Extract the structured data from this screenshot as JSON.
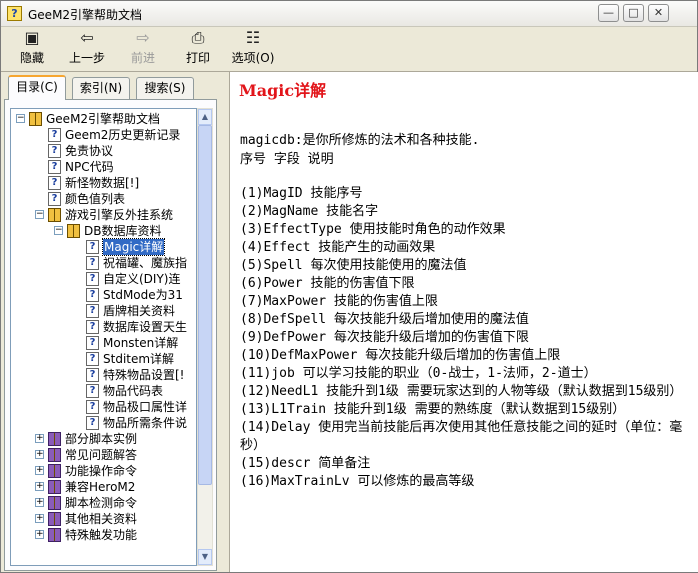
{
  "window": {
    "title": "GeeM2引擎帮助文档",
    "icon": "help-question-icon"
  },
  "title_buttons": {
    "minimize": "—",
    "maximize": "□",
    "close": "✕"
  },
  "toolbar": {
    "hide": "隐藏",
    "back": "上一步",
    "forward": "前进",
    "print": "打印",
    "options": "选项(O)"
  },
  "tabs": [
    "目录(C)",
    "索引(N)",
    "搜索(S)"
  ],
  "tree": [
    {
      "text": "GeeM2引擎帮助文档",
      "type": "book-open",
      "toggle": "−",
      "level": 0
    },
    {
      "text": "Geem2历史更新记录",
      "type": "page",
      "level": 1
    },
    {
      "text": "免责协议",
      "type": "page",
      "level": 1
    },
    {
      "text": "NPC代码",
      "type": "page",
      "level": 1
    },
    {
      "text": "新怪物数据[!]",
      "type": "page",
      "level": 1
    },
    {
      "text": "颜色值列表",
      "type": "page",
      "level": 1
    },
    {
      "text": "游戏引擎反外挂系统",
      "type": "book-open",
      "toggle": "−",
      "level": 1
    },
    {
      "text": "DB数据库资料",
      "type": "book-open",
      "toggle": "−",
      "level": 2
    },
    {
      "text": "Magic详解",
      "type": "page",
      "level": 3,
      "selected": true
    },
    {
      "text": "祝福罐、魔族指",
      "type": "page",
      "level": 3
    },
    {
      "text": "自定义(DIY)连",
      "type": "page",
      "level": 3
    },
    {
      "text": "StdMode为31",
      "type": "page",
      "level": 3
    },
    {
      "text": "盾牌相关资料",
      "type": "page",
      "level": 3
    },
    {
      "text": "数据库设置天生",
      "type": "page",
      "level": 3
    },
    {
      "text": "Monsten详解",
      "type": "page",
      "level": 3
    },
    {
      "text": "Stditem详解",
      "type": "page",
      "level": 3
    },
    {
      "text": "特殊物品设置[!",
      "type": "page",
      "level": 3
    },
    {
      "text": "物品代码表",
      "type": "page",
      "level": 3
    },
    {
      "text": "物品极口属性详",
      "type": "page",
      "level": 3
    },
    {
      "text": "物品所需条件说",
      "type": "page",
      "level": 3
    },
    {
      "text": "部分脚本实例",
      "type": "book-closed",
      "toggle": "+",
      "level": 1
    },
    {
      "text": "常见问题解答",
      "type": "book-closed",
      "toggle": "+",
      "level": 1
    },
    {
      "text": "功能操作命令",
      "type": "book-closed",
      "toggle": "+",
      "level": 1
    },
    {
      "text": "兼容HeroM2",
      "type": "book-closed",
      "toggle": "+",
      "level": 1
    },
    {
      "text": "脚本检测命令",
      "type": "book-closed",
      "toggle": "+",
      "level": 1
    },
    {
      "text": "其他相关资料",
      "type": "book-closed",
      "toggle": "+",
      "level": 1
    },
    {
      "text": "特殊触发功能",
      "type": "book-closed",
      "toggle": "+",
      "level": 1
    }
  ],
  "content": {
    "title": "Magic详解",
    "intro": "magicdb:是你所修炼的法术和各种技能.",
    "header": " 序号 字段 说明",
    "fields": [
      "(1)MagID 技能序号",
      " (2)MagName 技能名字",
      " (3)EffectType 使用技能时角色的动作效果",
      " (4)Effect 技能产生的动画效果",
      " (5)Spell 每次使用技能使用的魔法值",
      " (6)Power 技能的伤害值下限",
      " (7)MaxPower 技能的伤害值上限",
      "(8)DefSpell 每次技能升级后增加使用的魔法值",
      " (9)DefPower 每次技能升级后增加的伤害值下限",
      " (10)DefMaxPower 每次技能升级后增加的伤害值上限",
      " (11)job 可以学习技能的职业（0-战士，1-法师，2-道士）",
      " (12)NeedL1 技能升到1级 需要玩家达到的人物等级（默认数据到15级别）",
      " (13)L1Train 技能升到1级 需要的熟练度（默认数据到15级别）",
      "(14)Delay 使用完当前技能后再次使用其他任意技能之间的延时（单位：毫秒）",
      "(15)descr 简单备注",
      " (16)MaxTrainLv 可以修炼的最高等级"
    ]
  }
}
